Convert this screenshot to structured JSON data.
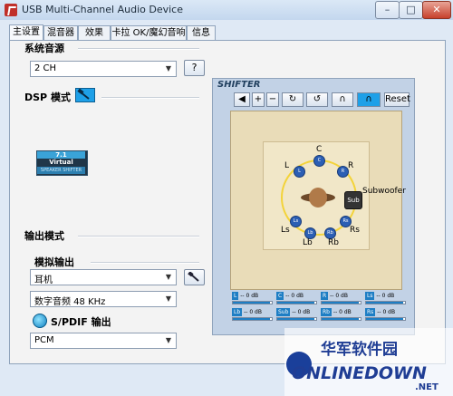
{
  "window": {
    "title": "USB Multi-Channel Audio Device",
    "minimize": "–",
    "maximize": "□",
    "close": "✕"
  },
  "tabs": [
    {
      "label": "主设置",
      "active": true
    },
    {
      "label": "混音器"
    },
    {
      "label": "效果"
    },
    {
      "label": "卡拉 OK/魔幻音响"
    },
    {
      "label": "信息"
    }
  ],
  "system_source": {
    "section_label": "系统音源",
    "channel_select": "2 CH",
    "help_button": "?"
  },
  "dsp": {
    "label": "DSP 模式",
    "badge_top": "7.1",
    "badge_mid": "Virtual",
    "badge_bottom": "SPEAKER SHIFTER"
  },
  "output": {
    "section_label": "输出模式",
    "analog_label": "模拟输出",
    "device_select": "耳机",
    "format_select": "数字音频 48 KHz",
    "spdif_label": "S/PDIF 输出",
    "spdif_select": "PCM"
  },
  "shifter": {
    "title": "SHIFTER",
    "tools": [
      "◀",
      "+",
      "−",
      "↻",
      "↺",
      "∩",
      "∩",
      "Reset"
    ],
    "speakers": {
      "C": "C",
      "L": "L",
      "R": "R",
      "Ls": "Ls",
      "Rs": "Rs",
      "Lb": "Lb",
      "Rb": "Rb",
      "Sub": "Sub",
      "Subwoofer": "Subwoofer"
    },
    "meters": [
      {
        "ch": "L",
        "db": "-- 0 dB",
        "level": 0.95
      },
      {
        "ch": "C",
        "db": "-- 0 dB",
        "level": 0.95
      },
      {
        "ch": "R",
        "db": "-- 0 dB",
        "level": 0.95
      },
      {
        "ch": "Ls",
        "db": "-- 0 dB",
        "level": 0.95
      },
      {
        "ch": "Lb",
        "db": "-- 0 dB",
        "level": 0.95
      },
      {
        "ch": "Sub",
        "db": "-- 0 dB",
        "level": 0.95
      },
      {
        "ch": "Rb",
        "db": "-- 0 dB",
        "level": 0.95
      },
      {
        "ch": "Rs",
        "db": "-- 0 dB",
        "level": 0.95
      }
    ]
  },
  "watermark": {
    "text_cn": "华军软件园",
    "text_en": "ONLINEDOWN",
    "suffix": ".NET"
  }
}
